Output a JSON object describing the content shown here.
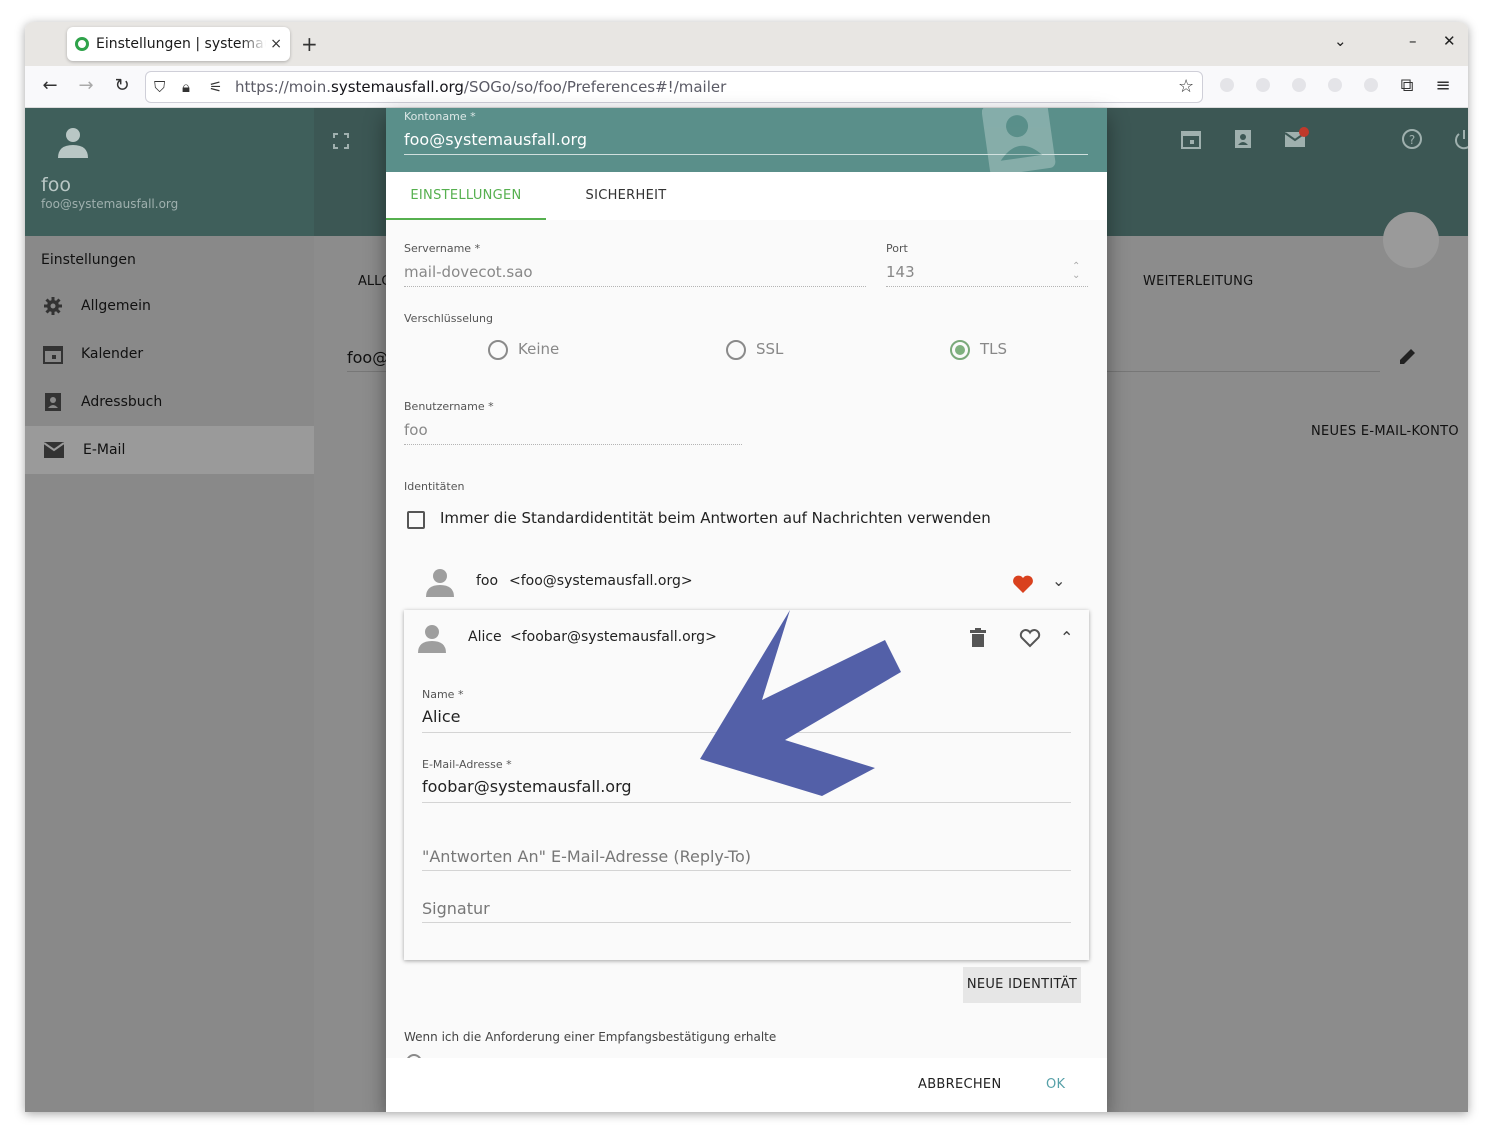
{
  "browser": {
    "tab_title": "Einstellungen | systemausfall",
    "tab_close": "×",
    "new_tab": "+",
    "url_scheme": "https://moin.",
    "url_host": "systemausfall.org",
    "url_path": "/SOGo/so/foo/Preferences#!/mailer"
  },
  "user": {
    "name": "foo",
    "email": "foo@systemausfall.org"
  },
  "sidebar": {
    "title": "Einstellungen",
    "items": [
      {
        "label": "Allgemein",
        "icon": "gear-icon"
      },
      {
        "label": "Kalender",
        "icon": "calendar-icon"
      },
      {
        "label": "Adressbuch",
        "icon": "contacts-icon"
      },
      {
        "label": "E-Mail",
        "icon": "mail-icon"
      }
    ]
  },
  "background": {
    "tab_partial": "ALLG",
    "account_partial": "foo@",
    "forwarding_tab": "WEITERLEITUNG",
    "new_account": "NEUES E-MAIL-KONTO"
  },
  "dialog": {
    "account_label": "Kontoname *",
    "account_value": "foo@systemausfall.org",
    "tabs": [
      "EINSTELLUNGEN",
      "SICHERHEIT"
    ],
    "server_label": "Servername *",
    "server_value": "mail-dovecot.sao",
    "port_label": "Port",
    "port_value": "143",
    "encryption_label": "Verschlüsselung",
    "encryption_options": [
      "Keine",
      "SSL",
      "TLS"
    ],
    "encryption_selected": "TLS",
    "username_label": "Benutzername *",
    "username_value": "foo",
    "identities_label": "Identitäten",
    "always_default_label": "Immer die Standardidentität beim Antworten auf Nachrichten verwenden",
    "identity_1": {
      "name": "foo",
      "email": "<foo@systemausfall.org>"
    },
    "identity_2": {
      "name": "Alice",
      "email": "<foobar@systemausfall.org>",
      "name_label": "Name *",
      "name_value": "Alice",
      "email_label": "E-Mail-Adresse *",
      "email_value": "foobar@systemausfall.org",
      "replyto_placeholder": "\"Antworten An\" E-Mail-Adresse (Reply-To)",
      "signature_placeholder": "Signatur"
    },
    "new_identity": "NEUE IDENTITÄT",
    "receipt_label": "Wenn ich die Anforderung einer Empfangsbestätigung erhalte",
    "cancel": "ABBRECHEN",
    "ok": "OK"
  },
  "colors": {
    "accent_green": "#56b04f",
    "header_teal": "#5a8f8a",
    "favorite_red": "#d9411e",
    "annotation_arrow": "#5360a8"
  }
}
